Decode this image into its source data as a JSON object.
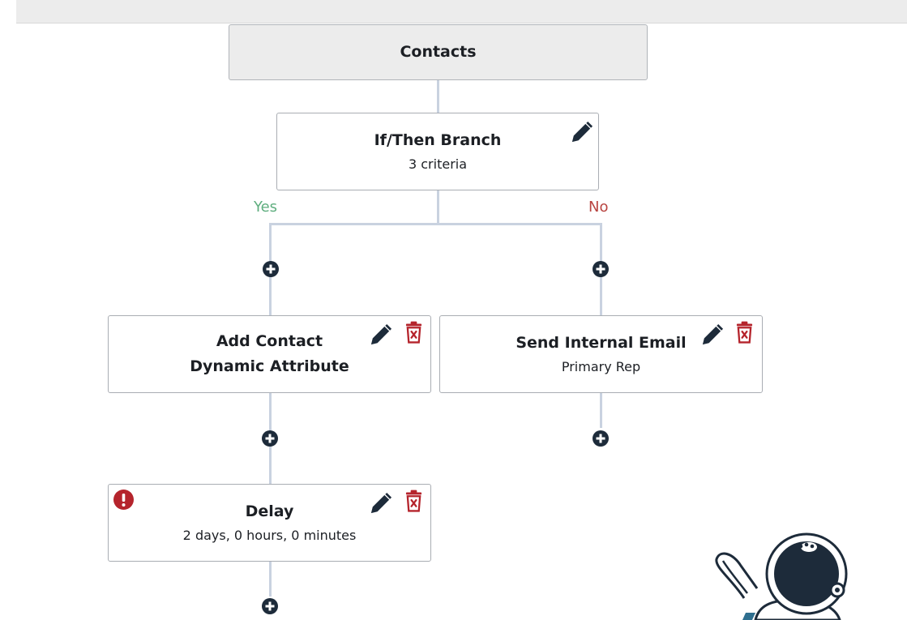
{
  "colors": {
    "connector": "#c9d2e0",
    "accent_dark": "#1d2b3a",
    "danger": "#b5242c",
    "yes": "#5fae7f",
    "no": "#b84340"
  },
  "workflow": {
    "root": {
      "title": "Contacts"
    },
    "branch": {
      "title": "If/Then Branch",
      "subtitle": "3 criteria",
      "yes_label": "Yes",
      "no_label": "No",
      "icons": [
        "edit-icon"
      ]
    },
    "yes_path": [
      {
        "title_line1": "Add Contact",
        "title_line2": "Dynamic Attribute",
        "icons": [
          "edit-icon",
          "delete-icon"
        ]
      },
      {
        "title": "Delay",
        "subtitle": "2 days, 0 hours, 0 minutes",
        "has_error": true,
        "icons": [
          "error-icon",
          "edit-icon",
          "delete-icon"
        ]
      }
    ],
    "no_path": [
      {
        "title": "Send Internal Email",
        "subtitle": "Primary Rep",
        "icons": [
          "edit-icon",
          "delete-icon"
        ]
      }
    ],
    "add_step_icon": "plus-circle-icon"
  },
  "decorations": {
    "mascot": "astronaut-mascot"
  }
}
